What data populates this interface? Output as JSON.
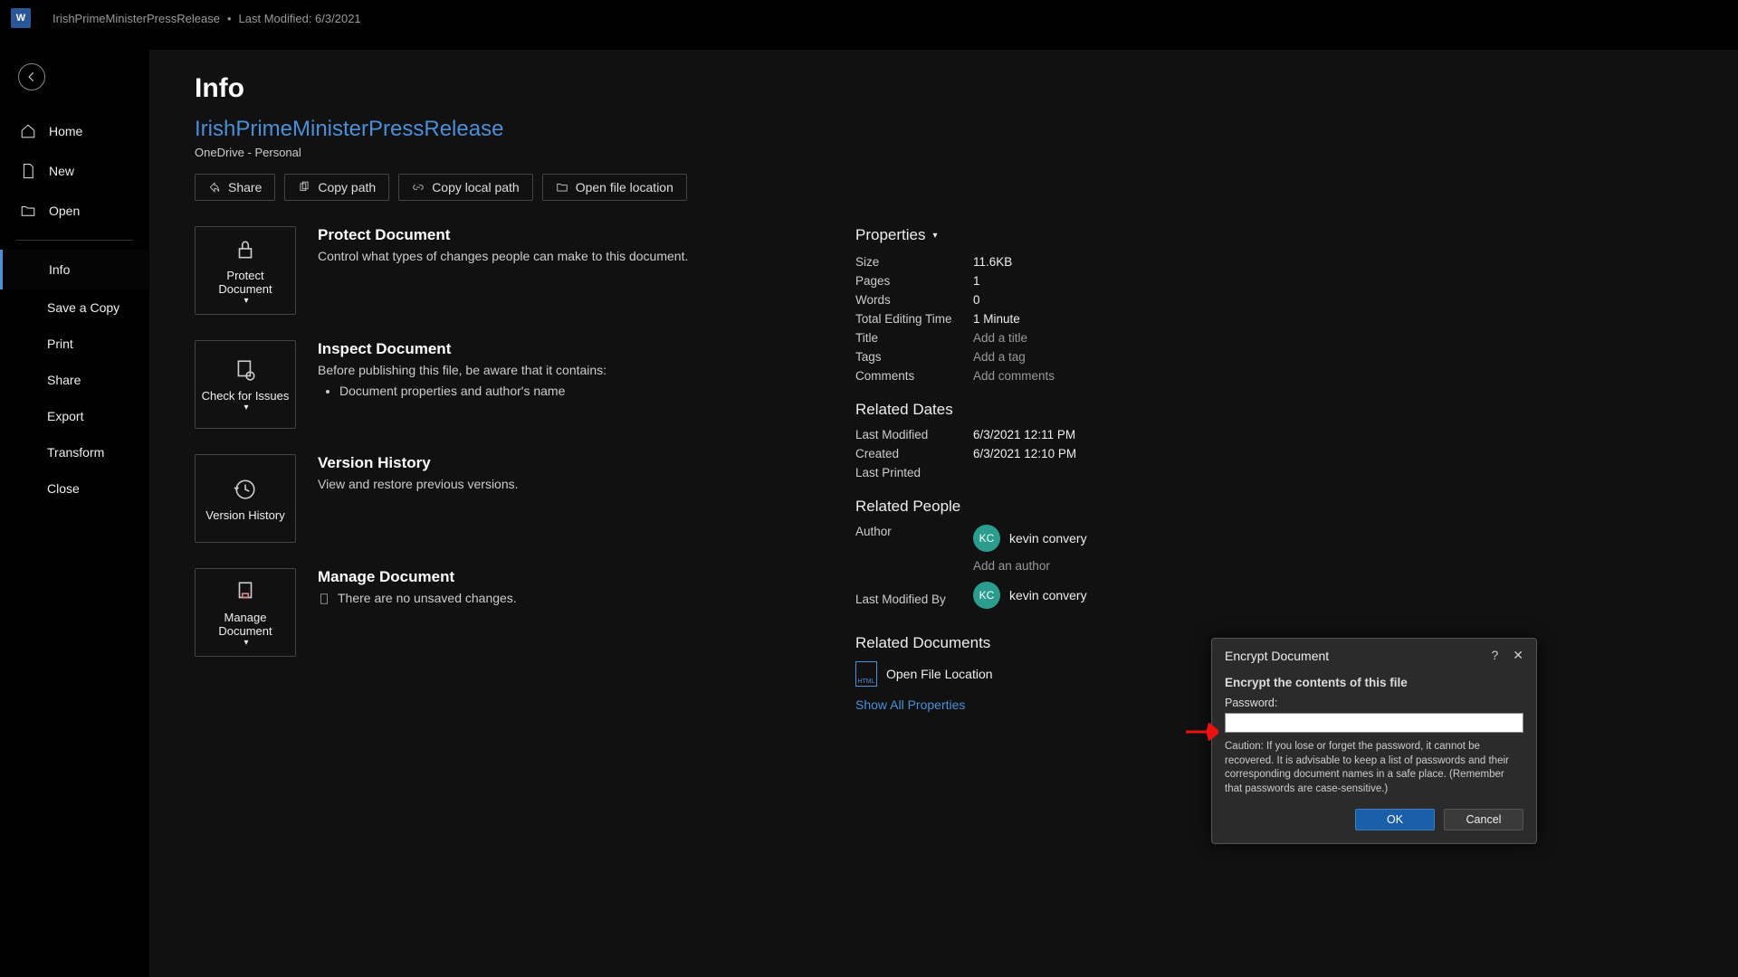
{
  "titlebar": {
    "doc_name": "IrishPrimeMinisterPressRelease",
    "modified_label": "Last Modified: 6/3/2021"
  },
  "sidebar": {
    "home": "Home",
    "new": "New",
    "open": "Open",
    "info": "Info",
    "save_copy": "Save a Copy",
    "print": "Print",
    "share": "Share",
    "export": "Export",
    "transform": "Transform",
    "close": "Close"
  },
  "main": {
    "title": "Info",
    "doc_name": "IrishPrimeMinisterPressRelease",
    "doc_location": "OneDrive - Personal",
    "actions": {
      "share": "Share",
      "copy_path": "Copy path",
      "copy_local_path": "Copy local path",
      "open_file_location": "Open file location"
    },
    "protect": {
      "button": "Protect Document",
      "heading": "Protect Document",
      "desc": "Control what types of changes people can make to this document."
    },
    "inspect": {
      "button": "Check for Issues",
      "heading": "Inspect Document",
      "desc": "Before publishing this file, be aware that it contains:",
      "bullet": "Document properties and author's name"
    },
    "version": {
      "button": "Version History",
      "heading": "Version History",
      "desc": "View and restore previous versions."
    },
    "manage": {
      "button": "Manage Document",
      "heading": "Manage Document",
      "desc": "There are no unsaved changes."
    }
  },
  "properties": {
    "header": "Properties",
    "size_label": "Size",
    "size_val": "11.6KB",
    "pages_label": "Pages",
    "pages_val": "1",
    "words_label": "Words",
    "words_val": "0",
    "edit_time_label": "Total Editing Time",
    "edit_time_val": "1 Minute",
    "title_label": "Title",
    "title_val": "Add a title",
    "tags_label": "Tags",
    "tags_val": "Add a tag",
    "comments_label": "Comments",
    "comments_val": "Add comments"
  },
  "related_dates": {
    "header": "Related Dates",
    "last_modified_label": "Last Modified",
    "last_modified_val": "6/3/2021 12:11 PM",
    "created_label": "Created",
    "created_val": "6/3/2021 12:10 PM",
    "last_printed_label": "Last Printed",
    "last_printed_val": ""
  },
  "related_people": {
    "header": "Related People",
    "author_label": "Author",
    "author_initials": "KC",
    "author_name": "kevin convery",
    "add_author": "Add an author",
    "modified_by_label": "Last Modified By",
    "modified_by_initials": "KC",
    "modified_by_name": "kevin convery"
  },
  "related_docs": {
    "header": "Related Documents",
    "open_file_location": "Open File Location",
    "show_all": "Show All Properties"
  },
  "dialog": {
    "title": "Encrypt Document",
    "heading": "Encrypt the contents of this file",
    "password_label": "Password:",
    "caution": "Caution: If you lose or forget the password, it cannot be recovered. It is advisable to keep a list of passwords and their corresponding document names in a safe place. (Remember that passwords are case-sensitive.)",
    "ok": "OK",
    "cancel": "Cancel"
  }
}
